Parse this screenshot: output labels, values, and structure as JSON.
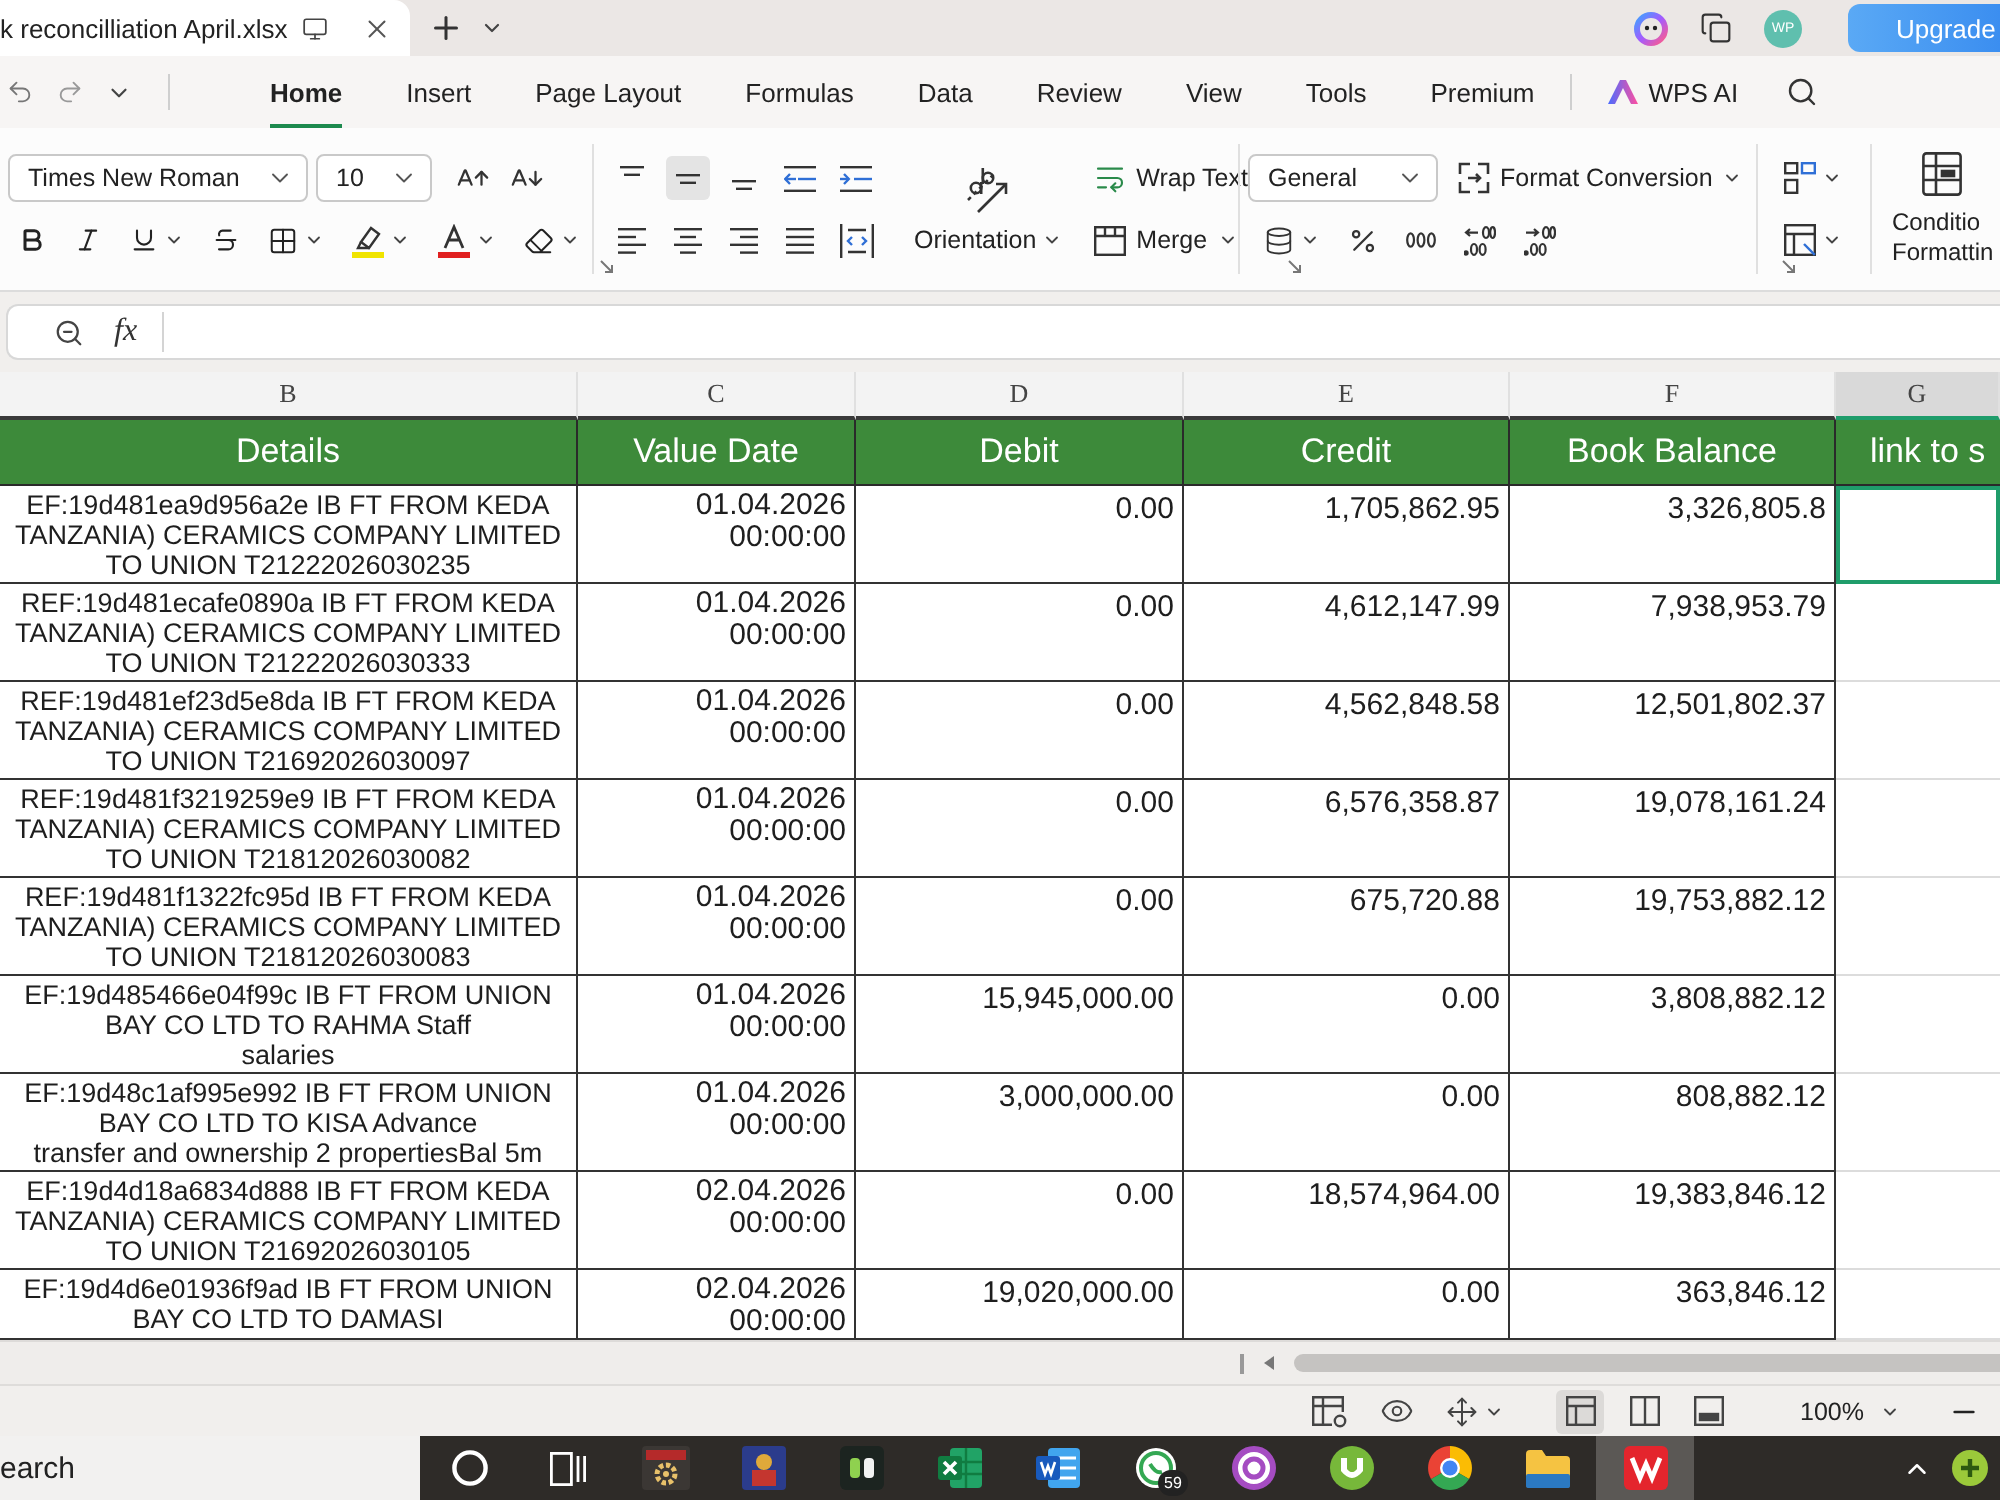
{
  "title_bar": {
    "document_title": "k reconcilliation April.xlsx",
    "avatar_initials": "WP",
    "upgrade": "Upgrade"
  },
  "menu_tabs": [
    {
      "kind": "tab",
      "label": "Home",
      "selected": true
    },
    {
      "kind": "tab",
      "label": "Insert",
      "selected": false
    },
    {
      "kind": "tab",
      "label": "Page Layout",
      "selected": false
    },
    {
      "kind": "tab",
      "label": "Formulas",
      "selected": false
    },
    {
      "kind": "tab",
      "label": "Data",
      "selected": false
    },
    {
      "kind": "tab",
      "label": "Review",
      "selected": false
    },
    {
      "kind": "tab",
      "label": "View",
      "selected": false
    },
    {
      "kind": "tab",
      "label": "Tools",
      "selected": false
    },
    {
      "kind": "tab",
      "label": "Premium",
      "selected": false
    },
    {
      "kind": "ai",
      "label": "WPS AI",
      "selected": false
    }
  ],
  "toolbar": {
    "font_name": "Times New Roman",
    "font_size": "10",
    "vertical_align": [
      {
        "kind": "top",
        "selected": false
      },
      {
        "kind": "middle",
        "selected": true
      },
      {
        "kind": "bottom",
        "selected": false
      }
    ],
    "wrap_text": "Wrap Text",
    "orientation": "Orientation",
    "merge": "Merge",
    "number_format": "General",
    "format_conversion": "Format Conversion",
    "conditional_formatting": [
      "Conditio",
      "Formattin"
    ]
  },
  "formula_bar": {
    "function_label": "fx"
  },
  "sheet": {
    "columns": [
      {
        "letter": "B",
        "heading": "Details",
        "selected": false
      },
      {
        "letter": "C",
        "heading": "Value Date",
        "selected": false
      },
      {
        "letter": "D",
        "heading": "Debit",
        "selected": false
      },
      {
        "letter": "E",
        "heading": "Credit",
        "selected": false
      },
      {
        "letter": "F",
        "heading": "Book Balance",
        "selected": false
      },
      {
        "letter": "G",
        "heading": "link to s",
        "selected": true
      }
    ],
    "rows": [
      {
        "details": [
          "EF:19d481ea9d956a2e IB FT FROM KEDA",
          "TANZANIA) CERAMICS COMPANY LIMITED",
          "TO UNION T21222026030235"
        ],
        "value_date": "01.04.2026 00:00:00",
        "debit": "0.00",
        "credit": "1,705,862.95",
        "book_balance": "3,326,805.8",
        "column_g_selected": true
      },
      {
        "details": [
          "REF:19d481ecafe0890a IB FT FROM KEDA",
          "TANZANIA) CERAMICS COMPANY LIMITED",
          "TO UNION T21222026030333"
        ],
        "value_date": "01.04.2026 00:00:00",
        "debit": "0.00",
        "credit": "4,612,147.99",
        "book_balance": "7,938,953.79",
        "column_g_selected": false
      },
      {
        "details": [
          "REF:19d481ef23d5e8da IB FT FROM KEDA",
          "TANZANIA) CERAMICS COMPANY LIMITED",
          "TO UNION T21692026030097"
        ],
        "value_date": "01.04.2026 00:00:00",
        "debit": "0.00",
        "credit": "4,562,848.58",
        "book_balance": "12,501,802.37",
        "column_g_selected": false
      },
      {
        "details": [
          "REF:19d481f3219259e9 IB FT FROM KEDA",
          "TANZANIA) CERAMICS COMPANY LIMITED",
          "TO UNION T21812026030082"
        ],
        "value_date": "01.04.2026 00:00:00",
        "debit": "0.00",
        "credit": "6,576,358.87",
        "book_balance": "19,078,161.24",
        "column_g_selected": false
      },
      {
        "details": [
          "REF:19d481f1322fc95d IB FT FROM KEDA",
          "TANZANIA) CERAMICS COMPANY LIMITED",
          "TO UNION T21812026030083"
        ],
        "value_date": "01.04.2026 00:00:00",
        "debit": "0.00",
        "credit": "675,720.88",
        "book_balance": "19,753,882.12",
        "column_g_selected": false
      },
      {
        "details": [
          "EF:19d485466e04f99c IB FT FROM UNION",
          "BAY CO LTD TO RAHMA Staff",
          "salaries"
        ],
        "value_date": "01.04.2026 00:00:00",
        "debit": "15,945,000.00",
        "credit": "0.00",
        "book_balance": "3,808,882.12",
        "column_g_selected": false
      },
      {
        "details": [
          "EF:19d48c1af995e992 IB FT FROM UNION",
          "BAY CO LTD TO KISA Advance",
          "transfer and ownership 2 propertiesBal 5m"
        ],
        "value_date": "01.04.2026 00:00:00",
        "debit": "3,000,000.00",
        "credit": "0.00",
        "book_balance": "808,882.12",
        "column_g_selected": false
      },
      {
        "details": [
          "EF:19d4d18a6834d888 IB FT FROM KEDA",
          "TANZANIA) CERAMICS COMPANY LIMITED",
          "TO UNION T21692026030105"
        ],
        "value_date": "02.04.2026 00:00:00",
        "debit": "0.00",
        "credit": "18,574,964.00",
        "book_balance": "19,383,846.12",
        "column_g_selected": false
      },
      {
        "details": [
          "EF:19d4d6e01936f9ad IB FT FROM UNION",
          "BAY CO LTD TO DAMASI"
        ],
        "value_date": "02.04.2026 00:00:00",
        "debit": "19,020,000.00",
        "credit": "0.00",
        "book_balance": "363,846.12",
        "column_g_selected": false
      }
    ]
  },
  "status_bar": {
    "views": [
      {
        "kind": "normal",
        "selected": true
      },
      {
        "kind": "page_break",
        "selected": false
      },
      {
        "kind": "page_layout",
        "selected": false
      }
    ],
    "zoom": "100%"
  },
  "taskbar": {
    "search_placeholder": "earch",
    "apps": [
      {
        "kind": "ring",
        "selected": false
      },
      {
        "kind": "task_view",
        "selected": false
      },
      {
        "kind": "gear_tile",
        "selected": false
      },
      {
        "kind": "poster_tile",
        "selected": false
      },
      {
        "kind": "dark_tile",
        "selected": false
      },
      {
        "kind": "spreadsheet",
        "selected": false
      },
      {
        "kind": "document",
        "selected": false
      },
      {
        "kind": "chat",
        "selected": false,
        "badge": "59"
      },
      {
        "kind": "ring_accent",
        "selected": false
      },
      {
        "kind": "round_logo",
        "selected": false
      },
      {
        "kind": "browser",
        "selected": false
      },
      {
        "kind": "folder",
        "selected": false
      },
      {
        "kind": "app_tile",
        "selected": true
      }
    ]
  }
}
